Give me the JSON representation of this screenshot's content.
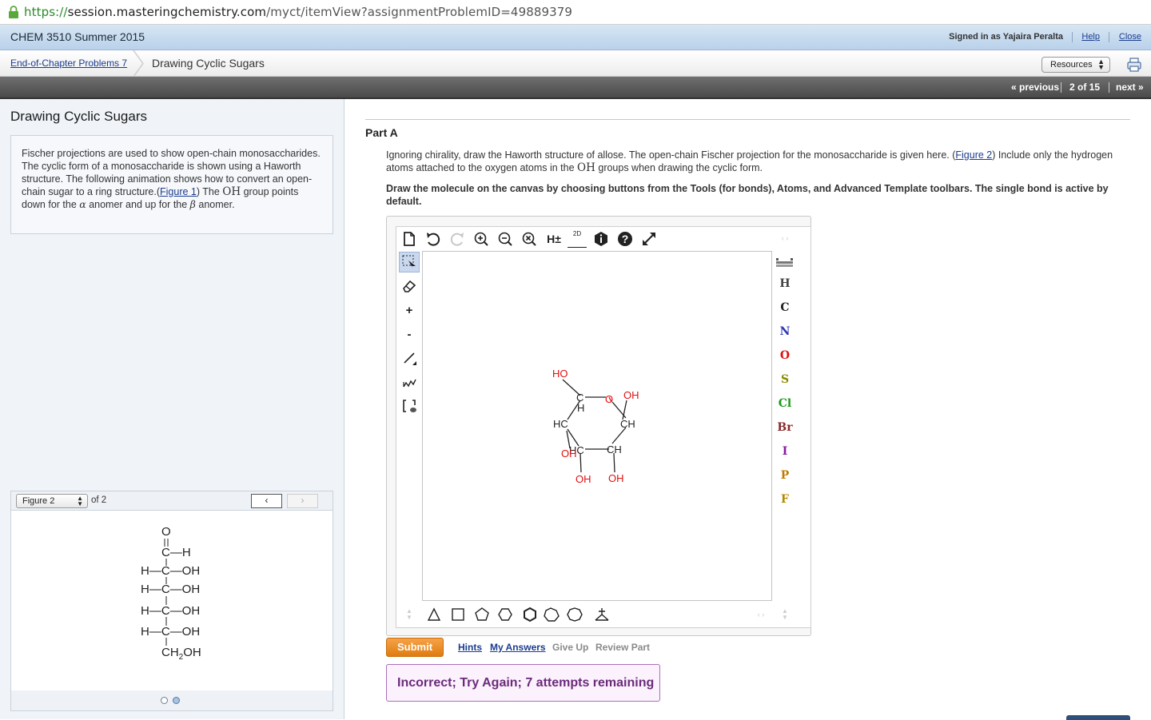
{
  "browser": {
    "scheme": "https://",
    "host": "session.masteringchemistry.com",
    "path": "/myct/itemView?assignmentProblemID=49889379"
  },
  "header": {
    "course_title": "CHEM 3510 Summer 2015",
    "signed_in": "Signed in as Yajaira Peralta",
    "help": "Help",
    "close": "Close"
  },
  "breadcrumb": {
    "parent": "End-of-Chapter Problems 7",
    "current": "Drawing Cyclic Sugars",
    "resources": "Resources"
  },
  "nav": {
    "previous": "« previous",
    "position": "2 of 15",
    "next": "next »"
  },
  "left": {
    "title": "Drawing Cyclic Sugars",
    "intro_1": "Fischer projections are used to show open-chain monosaccharides. The cyclic form of a monosaccharide is shown using a Haworth structure. The following animation shows how to convert an open-chain sugar to a ring structure.(",
    "intro_link": "Figure 1",
    "intro_2": ") The ",
    "intro_oh": "OH",
    "intro_3": " group points down for the ",
    "alpha": "α",
    "intro_4": " anomer and up for the ",
    "beta": "β",
    "intro_5": " anomer.",
    "figure_select": "Figure 2",
    "figure_of": "of 2",
    "prev_arrow": "‹",
    "next_arrow": "›",
    "fischer": {
      "top_o": "O",
      "c1": "C—H",
      "r2": "H—C—OH",
      "r3": "H—C—OH",
      "r4": "H—C—OH",
      "r5": "H—C—OH",
      "bottom": "CH",
      "bottom_sub": "2",
      "bottom_end": "OH"
    }
  },
  "part": {
    "label": "Part A",
    "question_1": "Ignoring chirality, draw the Haworth structure of allose. The open-chain Fischer projection for the monosaccharide is given here. (",
    "question_link": "Figure 2",
    "question_2": ") Include only the hydrogen atoms attached to the oxygen atoms in the ",
    "question_oh": "OH",
    "question_3": " groups when drawing the cyclic form.",
    "instruction": "Draw the molecule on the canvas by choosing buttons from the Tools (for bonds), Atoms, and Advanced Template toolbars. The single bond is active by default."
  },
  "sketcher": {
    "top_tools": [
      "new-doc-icon",
      "undo-icon",
      "redo-icon",
      "zoom-in-icon",
      "zoom-out-icon",
      "zoom-reset-icon",
      "h-toggle-icon",
      "2d-clean-icon",
      "info-icon",
      "help-icon",
      "fullscreen-icon"
    ],
    "h_toggle": "H±",
    "clean_2d": "2D",
    "plus": "+",
    "minus": "-",
    "atoms": [
      {
        "symbol": "H",
        "color": "#444444"
      },
      {
        "symbol": "C",
        "color": "#222222"
      },
      {
        "symbol": "N",
        "color": "#2b35b0"
      },
      {
        "symbol": "O",
        "color": "#e01010"
      },
      {
        "symbol": "S",
        "color": "#8a8a00"
      },
      {
        "symbol": "Cl",
        "color": "#1a9a1a"
      },
      {
        "symbol": "Br",
        "color": "#8a2a2a"
      },
      {
        "symbol": "I",
        "color": "#8a1aa0"
      },
      {
        "symbol": "P",
        "color": "#c07a00"
      },
      {
        "symbol": "F",
        "color": "#b08a00"
      }
    ],
    "drawing": {
      "ho_top": "HO",
      "c_top": "C",
      "o_ring": "O",
      "oh_right": "OH",
      "h_under_c": "H",
      "hc_left": "HC",
      "ch_right": "CH",
      "hc_bottom": "HC",
      "oh_overlap": "OH",
      "ch_bottom": "CH",
      "oh_b1": "OH",
      "oh_b2": "OH"
    }
  },
  "actions": {
    "submit": "Submit",
    "hints": "Hints",
    "my_answers": "My Answers",
    "give_up": "Give Up",
    "review_part": "Review Part"
  },
  "feedback": "Incorrect; Try Again; 7 attempts remaining"
}
